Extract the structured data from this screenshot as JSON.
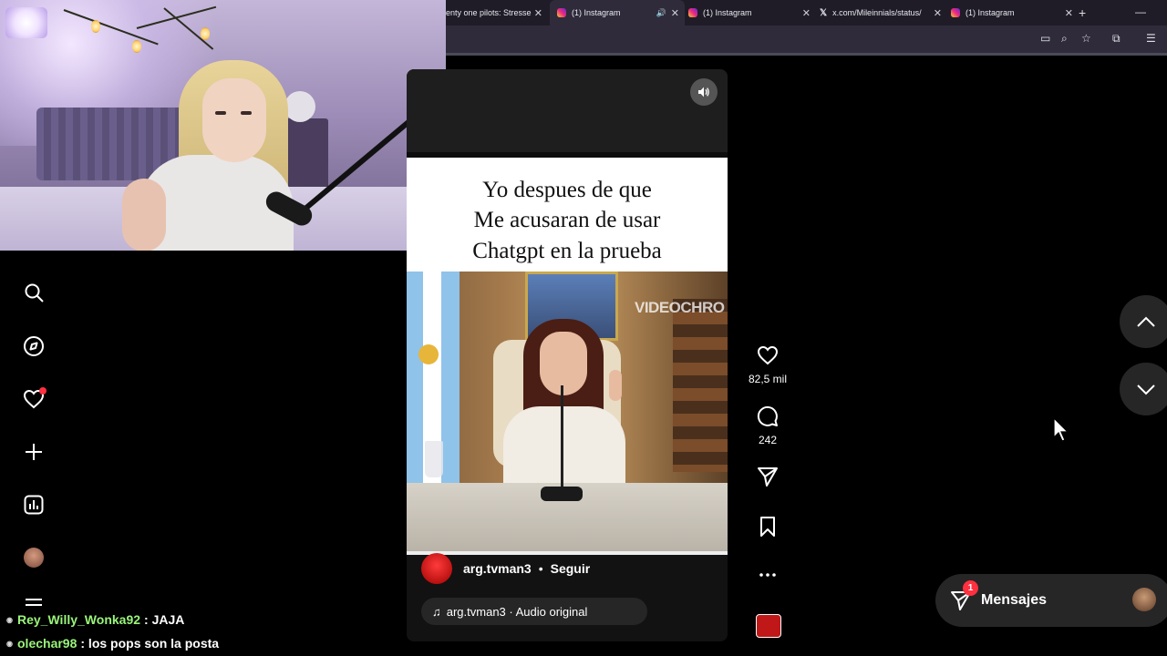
{
  "browser": {
    "tabs": [
      {
        "title": "enty one pilots: Stresse",
        "icon": "twitch-icon"
      },
      {
        "title": "(1) Instagram",
        "icon": "instagram-icon",
        "active": true,
        "playing_audio": true
      },
      {
        "title": "(1) Instagram",
        "icon": "instagram-icon"
      },
      {
        "title": "x.com/Mileinnials/status/",
        "icon": "x-icon"
      },
      {
        "title": "(1) Instagram",
        "icon": "instagram-icon"
      }
    ]
  },
  "reel": {
    "caption_lines": [
      "Yo despues de que",
      "Me acusaran de usar",
      "Chatgpt en la prueba"
    ],
    "watermark": "VIDEOCHRO",
    "author": "arg.tvman3",
    "separator": "•",
    "follow_label": "Seguir",
    "audio": "arg.tvman3 · Audio original",
    "likes": "82,5 mil",
    "comments": "242"
  },
  "messages": {
    "label": "Mensajes",
    "badge": "1"
  },
  "chat": [
    {
      "user": "Rey_Willy_Wonka92",
      "message": ": JAJA"
    },
    {
      "user": "olechar98",
      "message": ": los pops son la posta"
    }
  ],
  "colors": {
    "accent_red": "#ff3040",
    "chat_user": "#9af57a",
    "panel": "#262626"
  }
}
